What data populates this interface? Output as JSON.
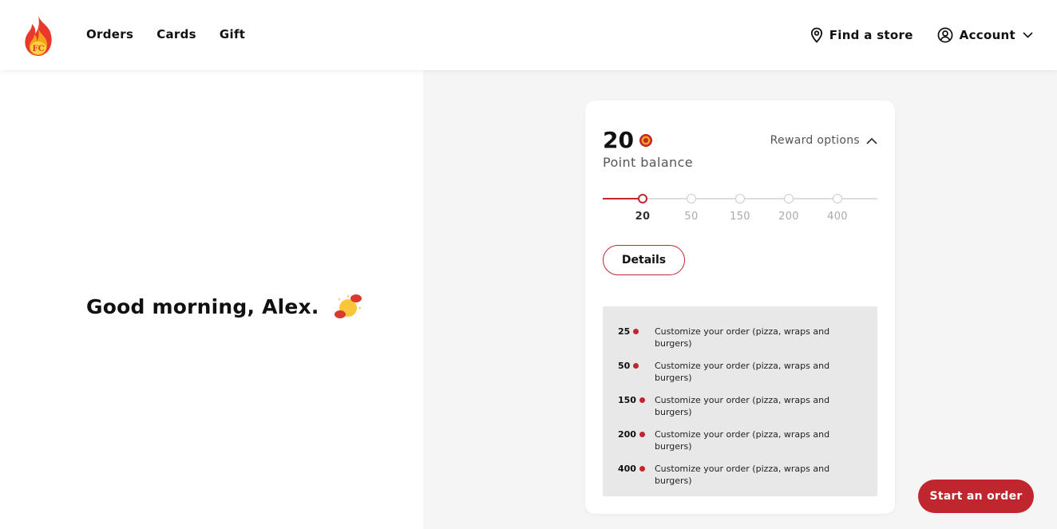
{
  "header": {
    "nav": [
      "Orders",
      "Cards",
      "Gift"
    ],
    "find_store": "Find a store",
    "account": "Account"
  },
  "greeting": "Good morning, Alex.",
  "card": {
    "points": "20",
    "points_label": "Point balance",
    "reward_options": "Reward options",
    "milestones": [
      "20",
      "50",
      "150",
      "200",
      "400"
    ],
    "active_milestone": 0,
    "details_label": "Details",
    "rewards": [
      {
        "points": "25",
        "desc": "Customize your order (pizza, wraps and burgers)"
      },
      {
        "points": "50",
        "desc": "Customize your order (pizza, wraps and burgers)"
      },
      {
        "points": "150",
        "desc": "Customize your order (pizza, wraps and burgers)"
      },
      {
        "points": "200",
        "desc": "Customize your order (pizza, wraps and burgers)"
      },
      {
        "points": "400",
        "desc": "Customize your order (pizza, wraps and burgers)"
      }
    ]
  },
  "start_order": "Start an order",
  "colors": {
    "accent": "#c0262d",
    "panel_bg": "#f5f5f5"
  }
}
